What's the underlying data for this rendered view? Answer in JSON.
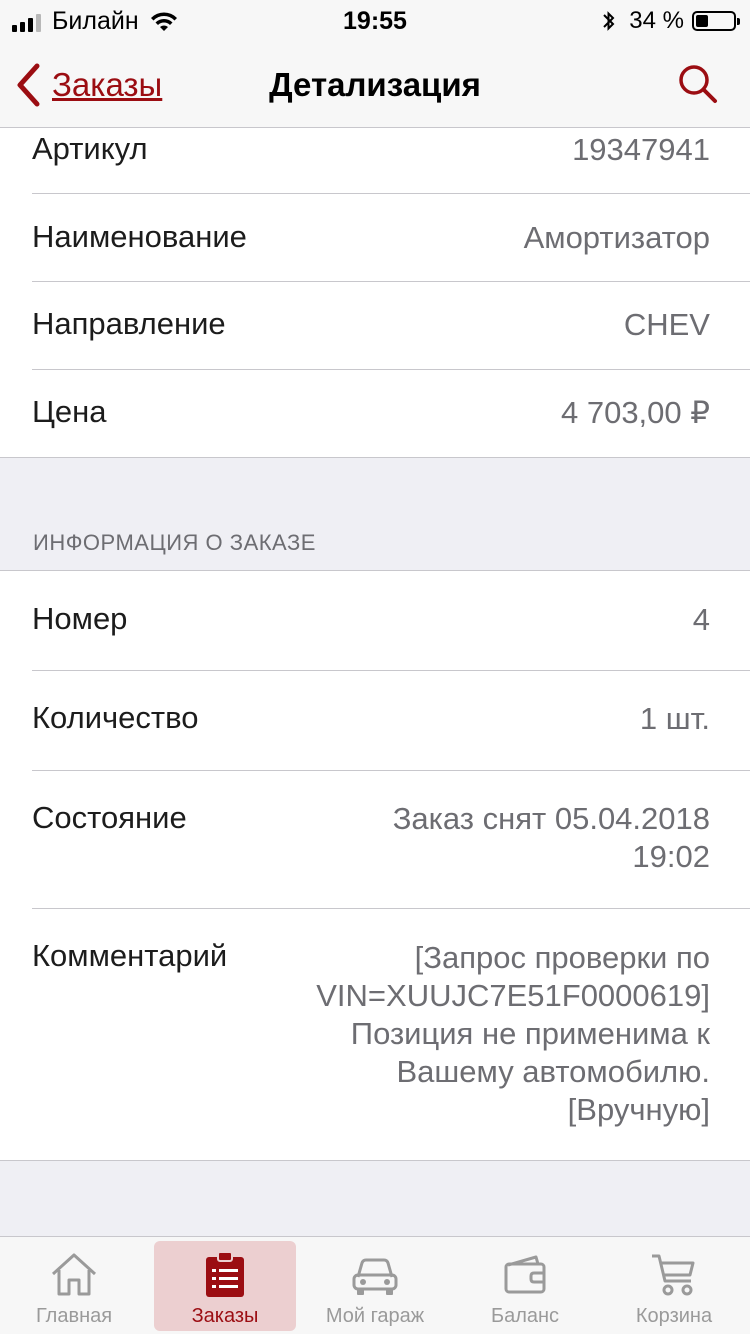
{
  "status_bar": {
    "carrier": "Билайн",
    "time": "19:55",
    "battery_text": "34 %",
    "battery_level": 0.34
  },
  "nav": {
    "back_label": "Заказы",
    "title": "Детализация"
  },
  "item_details": [
    {
      "label": "Артикул",
      "value": "19347941"
    },
    {
      "label": "Наименование",
      "value": "Амортизатор"
    },
    {
      "label": "Направление",
      "value": "CHEV"
    },
    {
      "label": "Цена",
      "value": "4 703,00 ₽"
    }
  ],
  "order_section": {
    "header": "ИНФОРМАЦИЯ О ЗАКАЗЕ",
    "rows": [
      {
        "label": "Номер",
        "value": "4"
      },
      {
        "label": "Количество",
        "value": "1 шт."
      },
      {
        "label": "Состояние",
        "value_lines": [
          "Заказ снят 05.04.2018",
          "19:02"
        ]
      },
      {
        "label": "Комментарий",
        "value_lines": [
          "[Запрос проверки по",
          "VIN=XUUJC7E51F0000619]",
          "Позиция не применима к",
          "Вашему автомобилю.",
          "[Вручную]"
        ]
      }
    ]
  },
  "tab_bar": {
    "tabs": [
      {
        "label": "Главная",
        "icon": "home-icon"
      },
      {
        "label": "Заказы",
        "icon": "orders-icon",
        "active": true
      },
      {
        "label": "Мой гараж",
        "icon": "car-icon"
      },
      {
        "label": "Баланс",
        "icon": "wallet-icon"
      },
      {
        "label": "Корзина",
        "icon": "cart-icon"
      }
    ]
  },
  "colors": {
    "accent": "#9b0d12",
    "active_tab_bg": "#eccfd0",
    "background": "#efeff4"
  }
}
